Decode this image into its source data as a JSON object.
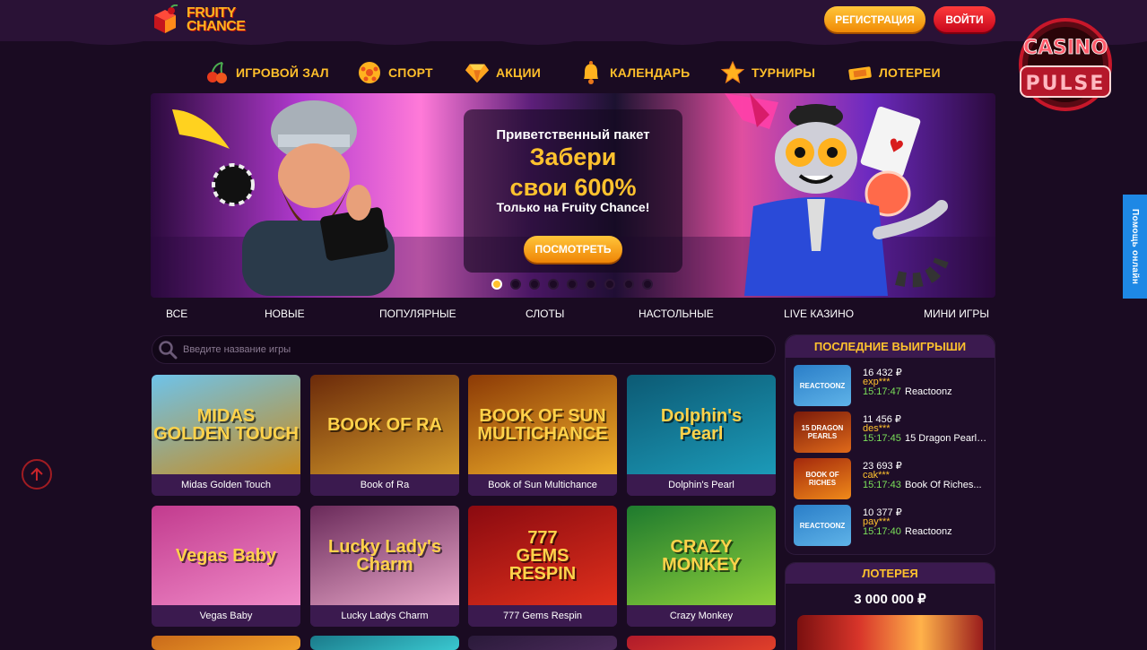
{
  "header": {
    "logo_text_line1": "FRUITY",
    "logo_text_line2": "CHANCE",
    "register_label": "РЕГИСТРАЦИЯ",
    "login_label": "ВОЙТИ",
    "badge_line1": "CASINO",
    "badge_line2": "PULSE"
  },
  "nav": {
    "items": [
      {
        "label": "ИГРОВОЙ ЗАЛ",
        "icon": "cherries-icon"
      },
      {
        "label": "СПОРТ",
        "icon": "ball-icon"
      },
      {
        "label": "АКЦИИ",
        "icon": "diamond-icon"
      },
      {
        "label": "КАЛЕНДАРЬ",
        "icon": "bell-icon"
      },
      {
        "label": "ТУРНИРЫ",
        "icon": "star-icon"
      },
      {
        "label": "ЛОТЕРЕИ",
        "icon": "ticket-icon"
      }
    ]
  },
  "banner": {
    "line1": "Приветственный пакет",
    "line2a": "Забери",
    "line2b": "свои 600%",
    "line3": "Только на Fruity Chance!",
    "button_label": "ПОСМОТРЕТЬ",
    "slides_total": 9,
    "active_slide": 1
  },
  "categories": [
    "ВСЕ",
    "НОВЫЕ",
    "ПОПУЛЯРНЫЕ",
    "СЛОТЫ",
    "НАСТОЛЬНЫЕ",
    "LIVE КАЗИНО",
    "МИНИ ИГРЫ"
  ],
  "search": {
    "placeholder": "Введите название игры"
  },
  "games": [
    {
      "name": "Midas Golden Touch",
      "art": "MIDAS\nGOLDEN TOUCH",
      "colors": [
        "#6ec3ea",
        "#c98b1c"
      ]
    },
    {
      "name": "Book of Ra",
      "art": "BOOK OF RA",
      "colors": [
        "#6b2a0a",
        "#d49a2a"
      ]
    },
    {
      "name": "Book of Sun Multichance",
      "art": "BOOK OF SUN\nMULTICHANCE",
      "colors": [
        "#8c3a06",
        "#f0b02a"
      ]
    },
    {
      "name": "Dolphin's Pearl",
      "art": "Dolphin's\nPearl",
      "colors": [
        "#0c5a74",
        "#1c9ab8"
      ]
    },
    {
      "name": "Vegas Baby",
      "art": "Vegas Baby",
      "colors": [
        "#c23b8e",
        "#f08ac8"
      ]
    },
    {
      "name": "Lucky Ladys Charm",
      "art": "Lucky Lady's\nCharm",
      "colors": [
        "#6a2a5a",
        "#e8a6c8"
      ]
    },
    {
      "name": "777 Gems Respin",
      "art": "777\nGEMS\nRESPIN",
      "colors": [
        "#8a0a10",
        "#e0301c"
      ]
    },
    {
      "name": "Crazy Monkey",
      "art": "CRAZY\nMONKEY",
      "colors": [
        "#1e7a2e",
        "#8ccf3a"
      ]
    }
  ],
  "recent_wins": {
    "title": "ПОСЛЕДНИЕ ВЫИГРЫШИ",
    "items": [
      {
        "amount": "16 432 ₽",
        "user": "exp***",
        "time": "15:17:47",
        "game": "Reactoonz",
        "thumb": "REACTOONZ",
        "colors": [
          "#2a7ec8",
          "#5fb3e8"
        ]
      },
      {
        "amount": "11 456 ₽",
        "user": "des***",
        "time": "15:17:45",
        "game": "15 Dragon Pearls:...",
        "thumb": "15 DRAGON PEARLS",
        "colors": [
          "#7a1a0a",
          "#e06a1a"
        ]
      },
      {
        "amount": "23 693 ₽",
        "user": "cak***",
        "time": "15:17:43",
        "game": "Book Of Riches...",
        "thumb": "BOOK OF RICHES",
        "colors": [
          "#a3280c",
          "#f08a1a"
        ]
      },
      {
        "amount": "10 377 ₽",
        "user": "pay***",
        "time": "15:17:40",
        "game": "Reactoonz",
        "thumb": "REACTOONZ",
        "colors": [
          "#2a7ec8",
          "#5fb3e8"
        ]
      }
    ]
  },
  "lottery": {
    "title": "ЛОТЕРЕЯ",
    "amount": "3 000 000 ₽"
  },
  "help": {
    "label": "Помощь онлайн"
  }
}
